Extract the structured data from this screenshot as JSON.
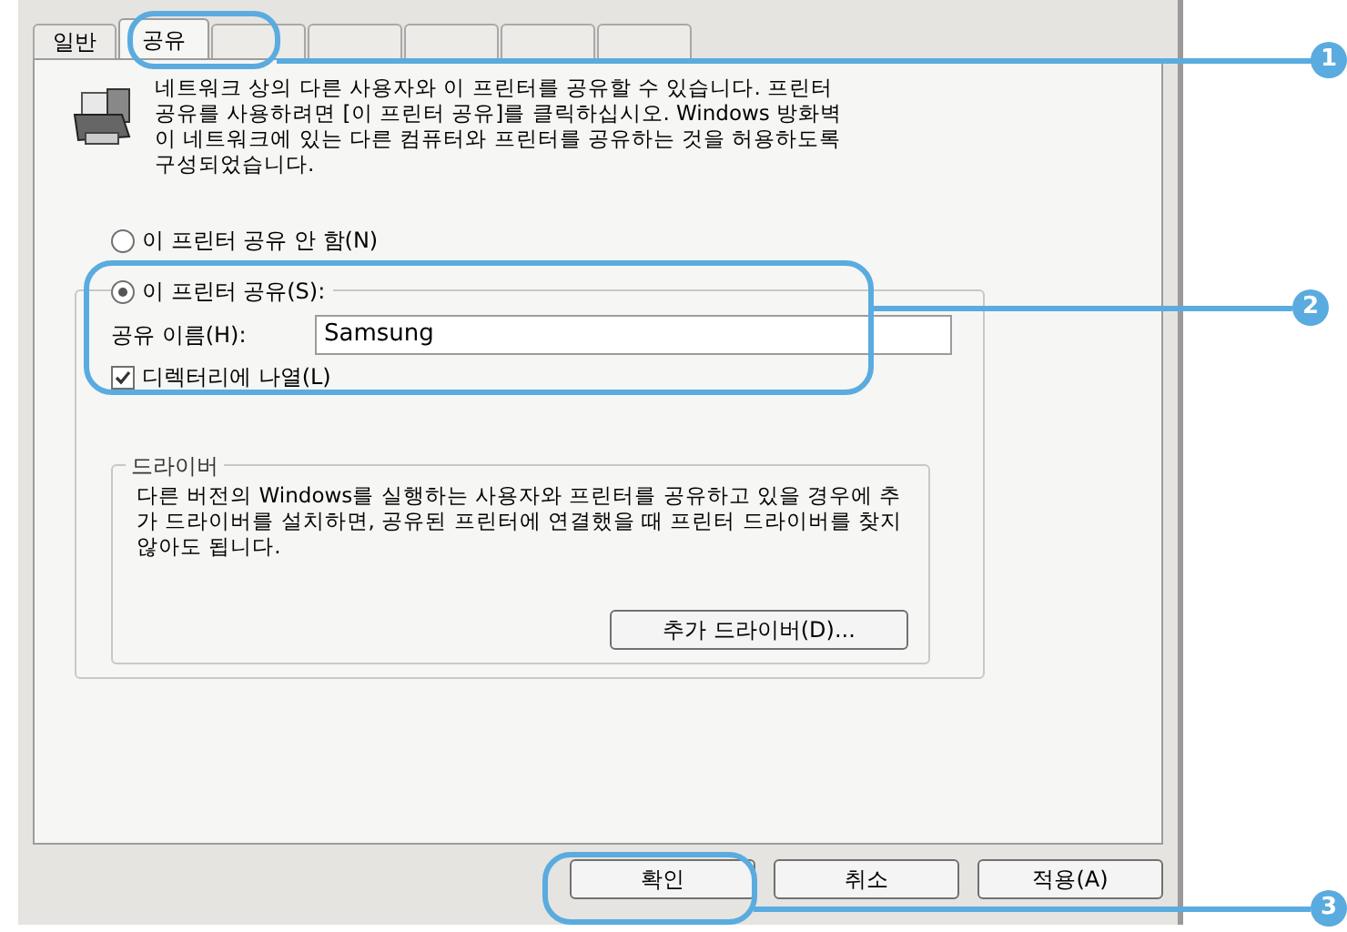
{
  "tabs": [
    {
      "label": "일반",
      "selected": false
    },
    {
      "label": "공유",
      "selected": true
    }
  ],
  "description": "네트워크 상의 다른 사용자와 이 프린터를 공유할 수 있습니다. 프린터 공유를 사용하려면 [이 프린터 공유]를 클릭하십시오. Windows 방화벽이 네트워크에 있는 다른 컴퓨터와 프린터를 공유하는 것을 허용하도록 구성되었습니다.",
  "sharing_options": [
    {
      "label": "이 프린터 공유 안 함(N)",
      "selected": false
    },
    {
      "label": "이 프린터 공유(S):",
      "selected": true
    }
  ],
  "share_name": {
    "label": "공유 이름(H):",
    "value": "Samsung"
  },
  "list_in_directory": {
    "label": "디렉터리에 나열(L)",
    "checked": true
  },
  "drivers": {
    "title": "드라이버",
    "text": "다른 버전의 Windows를 실행하는 사용자와 프린터를 공유하고 있을 경우에 추가 드라이버를 설치하면, 공유된 프린터에 연결했을 때 프린터 드라이버를 찾지 않아도 됩니다.",
    "button": "추가 드라이버(D)..."
  },
  "buttons": [
    "확인",
    "취소",
    "적용(A)"
  ],
  "callouts": [
    "1",
    "2",
    "3"
  ]
}
